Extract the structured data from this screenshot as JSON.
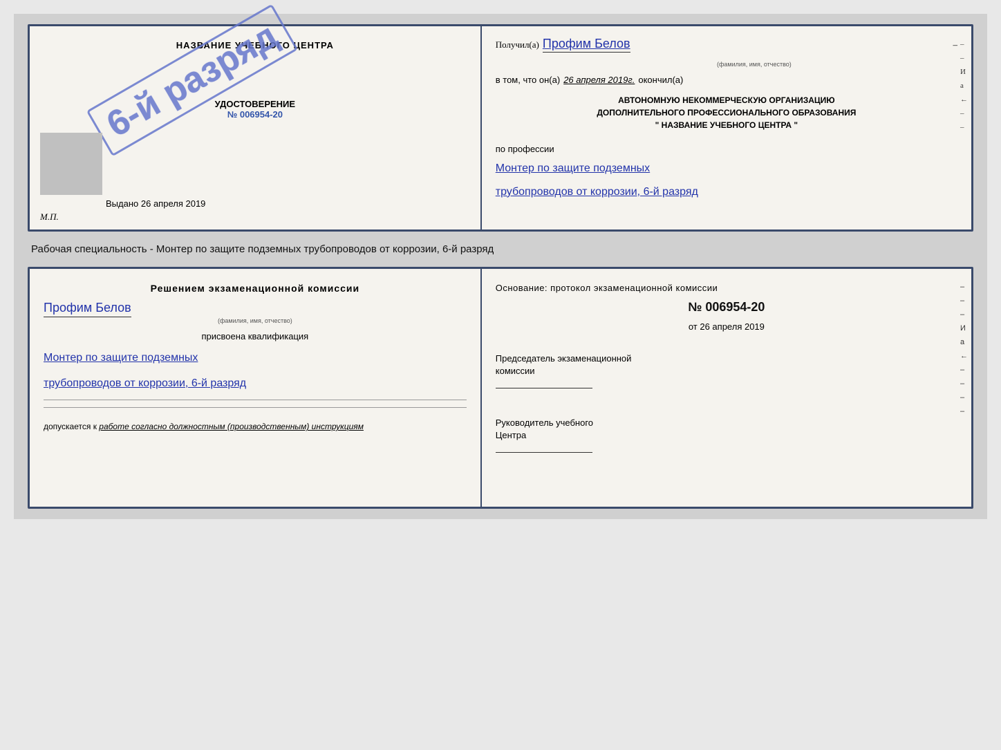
{
  "top_cert": {
    "left": {
      "school_name_label": "НАЗВАНИЕ УЧЕБНОГО ЦЕНТРА",
      "stamp_text": "6-й разряд",
      "udostoverenie_label": "УДОСТОВЕРЕНИЕ",
      "udostoverenie_num": "№ 006954-20",
      "vydano_label": "Выдано",
      "vydano_date": "26 апреля 2019",
      "mp_label": "М.П."
    },
    "right": {
      "poluchil_label": "Получил(а)",
      "poluchil_name": "Профим Белов",
      "fio_small": "(фамилия, имя, отчество)",
      "dash": "–",
      "vtom_label": "в том, что он(а)",
      "vtom_date": "26 апреля 2019г.",
      "okonchil_label": "окончил(а)",
      "org_line1": "АВТОНОМНУЮ НЕКОММЕРЧЕСКУЮ ОРГАНИЗАЦИЮ",
      "org_line2": "ДОПОЛНИТЕЛЬНОГО ПРОФЕССИОНАЛЬНОГО ОБРАЗОВАНИЯ",
      "org_line3": "\"    НАЗВАНИЕ УЧЕБНОГО ЦЕНТРА    \"",
      "profession_label": "по профессии",
      "profession_hw1": "Монтер по защите подземных",
      "profession_hw2": "трубопроводов от коррозии, 6-й разряд",
      "side_dashes": [
        "–",
        "–",
        "–",
        "И",
        "а",
        "←",
        "–",
        "–",
        "–"
      ]
    }
  },
  "middle": {
    "text": "Рабочая специальность - Монтер по защите подземных трубопроводов от коррозии, 6-й разряд"
  },
  "bottom_cert": {
    "left": {
      "reshenie_title": "Решением  экзаменационной  комиссии",
      "name_hw": "Профим Белов",
      "fio_small": "(фамилия, имя, отчество)",
      "prisvoena_label": "присвоена квалификация",
      "profession_hw1": "Монтер по защите подземных",
      "profession_hw2": "трубопроводов от коррозии, 6-й разряд",
      "dopuskaetsya_label": "допускается к",
      "dopuskaetsya_hw": "работе согласно должностным (производственным) инструкциям"
    },
    "right": {
      "osnovanie_label": "Основание: протокол экзаменационной комиссии",
      "num_label": "№ 006954-20",
      "ot_label": "от",
      "ot_date": "26 апреля 2019",
      "predsedatel_line1": "Председатель экзаменационной",
      "predsedatel_line2": "комиссии",
      "rukovoditel_line1": "Руководитель учебного",
      "rukovoditel_line2": "Центра",
      "side_dashes": [
        "–",
        "–",
        "–",
        "И",
        "а",
        "←",
        "–",
        "–",
        "–",
        "–"
      ]
    }
  }
}
